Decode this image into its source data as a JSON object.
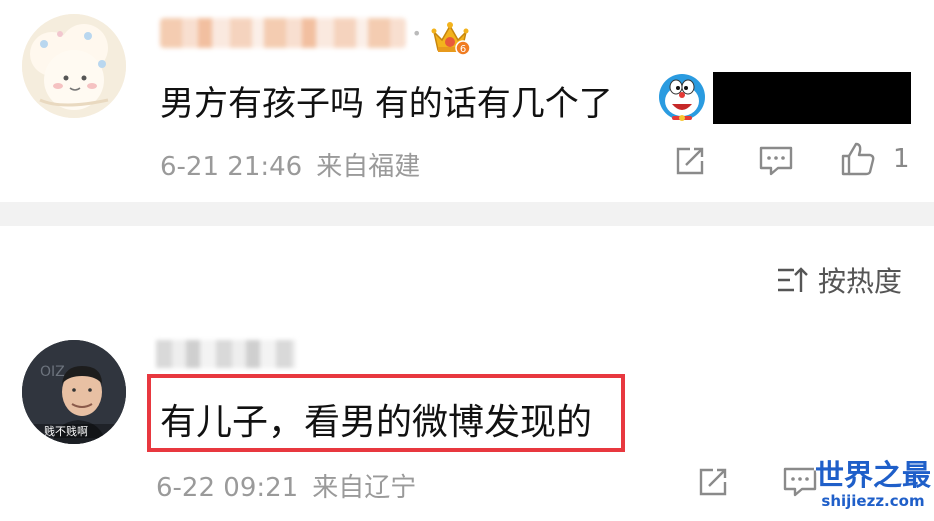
{
  "comment1": {
    "text": "男方有孩子吗 有的话有几个了",
    "date": "6-21 21:46",
    "location": "来自福建",
    "likes": "1",
    "badge": "6"
  },
  "sort": {
    "label": "按热度"
  },
  "comment2": {
    "avatar_caption": "贱不贱啊",
    "text": "有儿子，看男的微博发现的",
    "date": "6-22 09:21",
    "location": "来自辽宁"
  },
  "watermark": {
    "title": "世界之最",
    "url": "shijiezz.com"
  },
  "colors": {
    "highlight_border": "#e8383f",
    "watermark_blue": "#1f5fc9",
    "meta_gray": "#9a9a9a"
  },
  "icons": [
    "crown-icon",
    "doraemon-emoji-icon",
    "share-icon",
    "comment-icon",
    "like-icon",
    "sort-icon"
  ]
}
